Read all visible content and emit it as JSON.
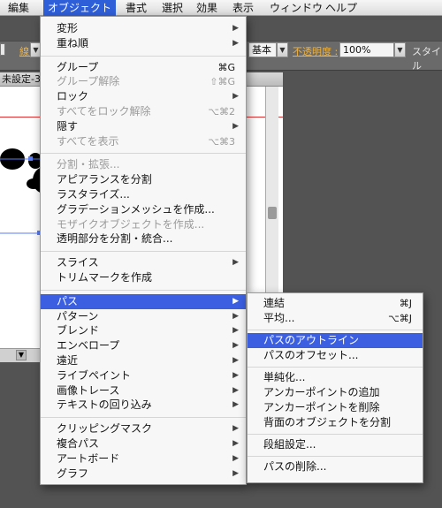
{
  "menubar": {
    "items": [
      "編集",
      "オブジェクト",
      "書式",
      "選択",
      "効果",
      "表示",
      "ウィンドウ",
      "ヘルプ"
    ],
    "active": "オブジェクト"
  },
  "control_bar": {
    "stroke_label": "線 :",
    "base_value": "基本",
    "opacity_label": "不透明度 :",
    "opacity_value": "100%",
    "style_label": "スタイル"
  },
  "document": {
    "tab_title": "未設定-3"
  },
  "object_menu": {
    "items": [
      {
        "label": "変形",
        "submenu": true
      },
      {
        "label": "重ね順",
        "submenu": true
      },
      {
        "sep": true
      },
      {
        "label": "グループ",
        "shortcut": "⌘G"
      },
      {
        "label": "グループ解除",
        "shortcut": "⇧⌘G",
        "disabled": true
      },
      {
        "label": "ロック",
        "submenu": true
      },
      {
        "label": "すべてをロック解除",
        "shortcut": "⌥⌘2",
        "disabled": true
      },
      {
        "label": "隠す",
        "submenu": true
      },
      {
        "label": "すべてを表示",
        "shortcut": "⌥⌘3",
        "disabled": true
      },
      {
        "sep": true
      },
      {
        "label": "分割・拡張...",
        "disabled": true
      },
      {
        "label": "アピアランスを分割"
      },
      {
        "label": "ラスタライズ..."
      },
      {
        "label": "グラデーションメッシュを作成..."
      },
      {
        "label": "モザイクオブジェクトを作成...",
        "disabled": true
      },
      {
        "label": "透明部分を分割・統合..."
      },
      {
        "sep": true
      },
      {
        "label": "スライス",
        "submenu": true
      },
      {
        "label": "トリムマークを作成"
      },
      {
        "sep": true
      },
      {
        "label": "パス",
        "submenu": true,
        "highlighted": true
      },
      {
        "label": "パターン",
        "submenu": true
      },
      {
        "label": "ブレンド",
        "submenu": true
      },
      {
        "label": "エンベロープ",
        "submenu": true
      },
      {
        "label": "遠近",
        "submenu": true
      },
      {
        "label": "ライブペイント",
        "submenu": true
      },
      {
        "label": "画像トレース",
        "submenu": true
      },
      {
        "label": "テキストの回り込み",
        "submenu": true
      },
      {
        "sep": true
      },
      {
        "label": "クリッピングマスク",
        "submenu": true
      },
      {
        "label": "複合パス",
        "submenu": true
      },
      {
        "label": "アートボード",
        "submenu": true
      },
      {
        "label": "グラフ",
        "submenu": true
      }
    ]
  },
  "path_submenu": {
    "items": [
      {
        "label": "連結",
        "shortcut": "⌘J"
      },
      {
        "label": "平均...",
        "shortcut": "⌥⌘J"
      },
      {
        "sep": true
      },
      {
        "label": "パスのアウトライン",
        "highlighted": true
      },
      {
        "label": "パスのオフセット..."
      },
      {
        "sep": true
      },
      {
        "label": "単純化..."
      },
      {
        "label": "アンカーポイントの追加"
      },
      {
        "label": "アンカーポイントを削除"
      },
      {
        "label": "背面のオブジェクトを分割"
      },
      {
        "sep": true
      },
      {
        "label": "段組設定..."
      },
      {
        "sep": true
      },
      {
        "label": "パスの削除..."
      }
    ]
  },
  "colors": {
    "menu_highlight": "#3b5fe0",
    "menubar_active": "#2f5fd8",
    "control_link": "#f2b23a"
  }
}
